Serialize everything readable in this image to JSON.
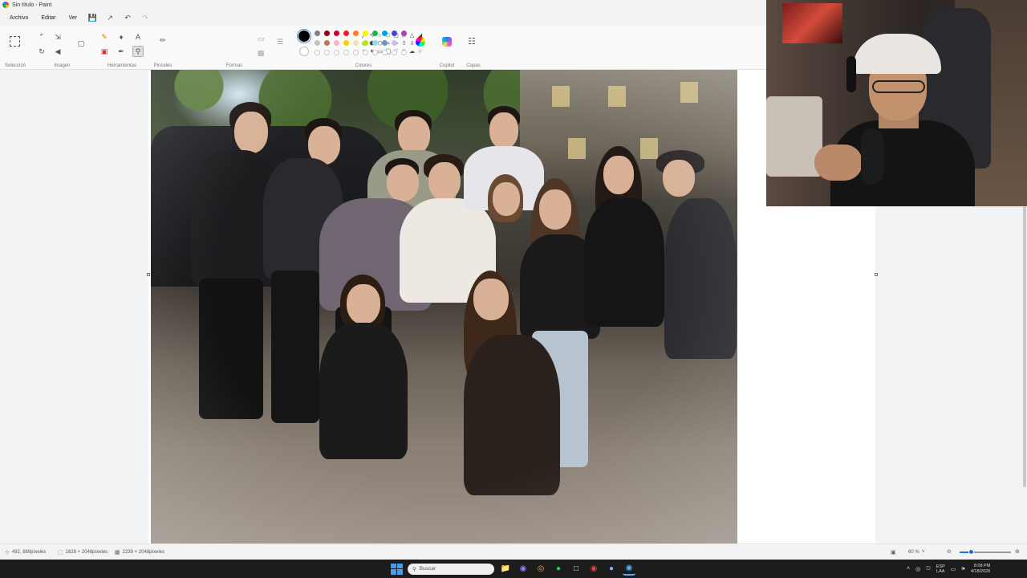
{
  "window": {
    "title": "Sin título - Paint"
  },
  "menu": {
    "items": [
      "Archivo",
      "Editar",
      "Ver"
    ]
  },
  "ribbon": {
    "groups": {
      "seleccion": "Selección",
      "imagen": "Imagen",
      "herramientas": "Herramientas",
      "pinceles": "Pinceles",
      "formas": "Formas",
      "colores": "Colores",
      "copilot": "Copilot",
      "capas": "Capas"
    },
    "palette_row1": [
      "#000000",
      "#7f7f7f",
      "#880015",
      "#c8002c",
      "#ed1c24",
      "#ff7f27",
      "#fff200",
      "#22b14c",
      "#00a2e8",
      "#3f48cc",
      "#a349a4"
    ],
    "palette_row2": [
      "#ffffff",
      "#c3c3c3",
      "#b97a57",
      "#ffaec9",
      "#ffc90e",
      "#efe4b0",
      "#b5e61d",
      "#99d9ea",
      "#7092be",
      "#c8bfe7"
    ],
    "primary_color": "#000000",
    "secondary_color": "#ffffff"
  },
  "status": {
    "cursor_pos": "492, 889píxeles",
    "selection_size": "1628 × 2048píxeles",
    "image_size": "2239 × 2048píxeles",
    "zoom": "60 %",
    "zoom_level": 0.22
  },
  "taskbar": {
    "search_placeholder": "Buscar",
    "lang_top": "ESP",
    "lang_bottom": "LAA",
    "time": "8:08 PM",
    "date": "4/18/2026"
  }
}
